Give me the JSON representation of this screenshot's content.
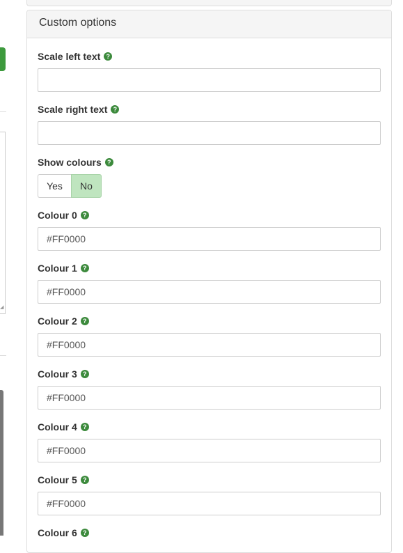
{
  "panel": {
    "title": "Custom options"
  },
  "fields": {
    "scale_left": {
      "label": "Scale left text",
      "value": ""
    },
    "scale_right": {
      "label": "Scale right text",
      "value": ""
    },
    "show_colours": {
      "label": "Show colours",
      "yes_label": "Yes",
      "no_label": "No",
      "selected": "No"
    },
    "colour_0": {
      "label": "Colour 0",
      "value": "#FF0000"
    },
    "colour_1": {
      "label": "Colour 1",
      "value": "#FF0000"
    },
    "colour_2": {
      "label": "Colour 2",
      "value": "#FF0000"
    },
    "colour_3": {
      "label": "Colour 3",
      "value": "#FF0000"
    },
    "colour_4": {
      "label": "Colour 4",
      "value": "#FF0000"
    },
    "colour_5": {
      "label": "Colour 5",
      "value": "#FF0000"
    },
    "colour_6": {
      "label": "Colour 6"
    }
  },
  "icons": {
    "help": "question-circle-icon",
    "help_glyph": "?"
  },
  "colors": {
    "accent_green": "#3c8a3c",
    "toggle_selected": "#bfe5bf"
  }
}
